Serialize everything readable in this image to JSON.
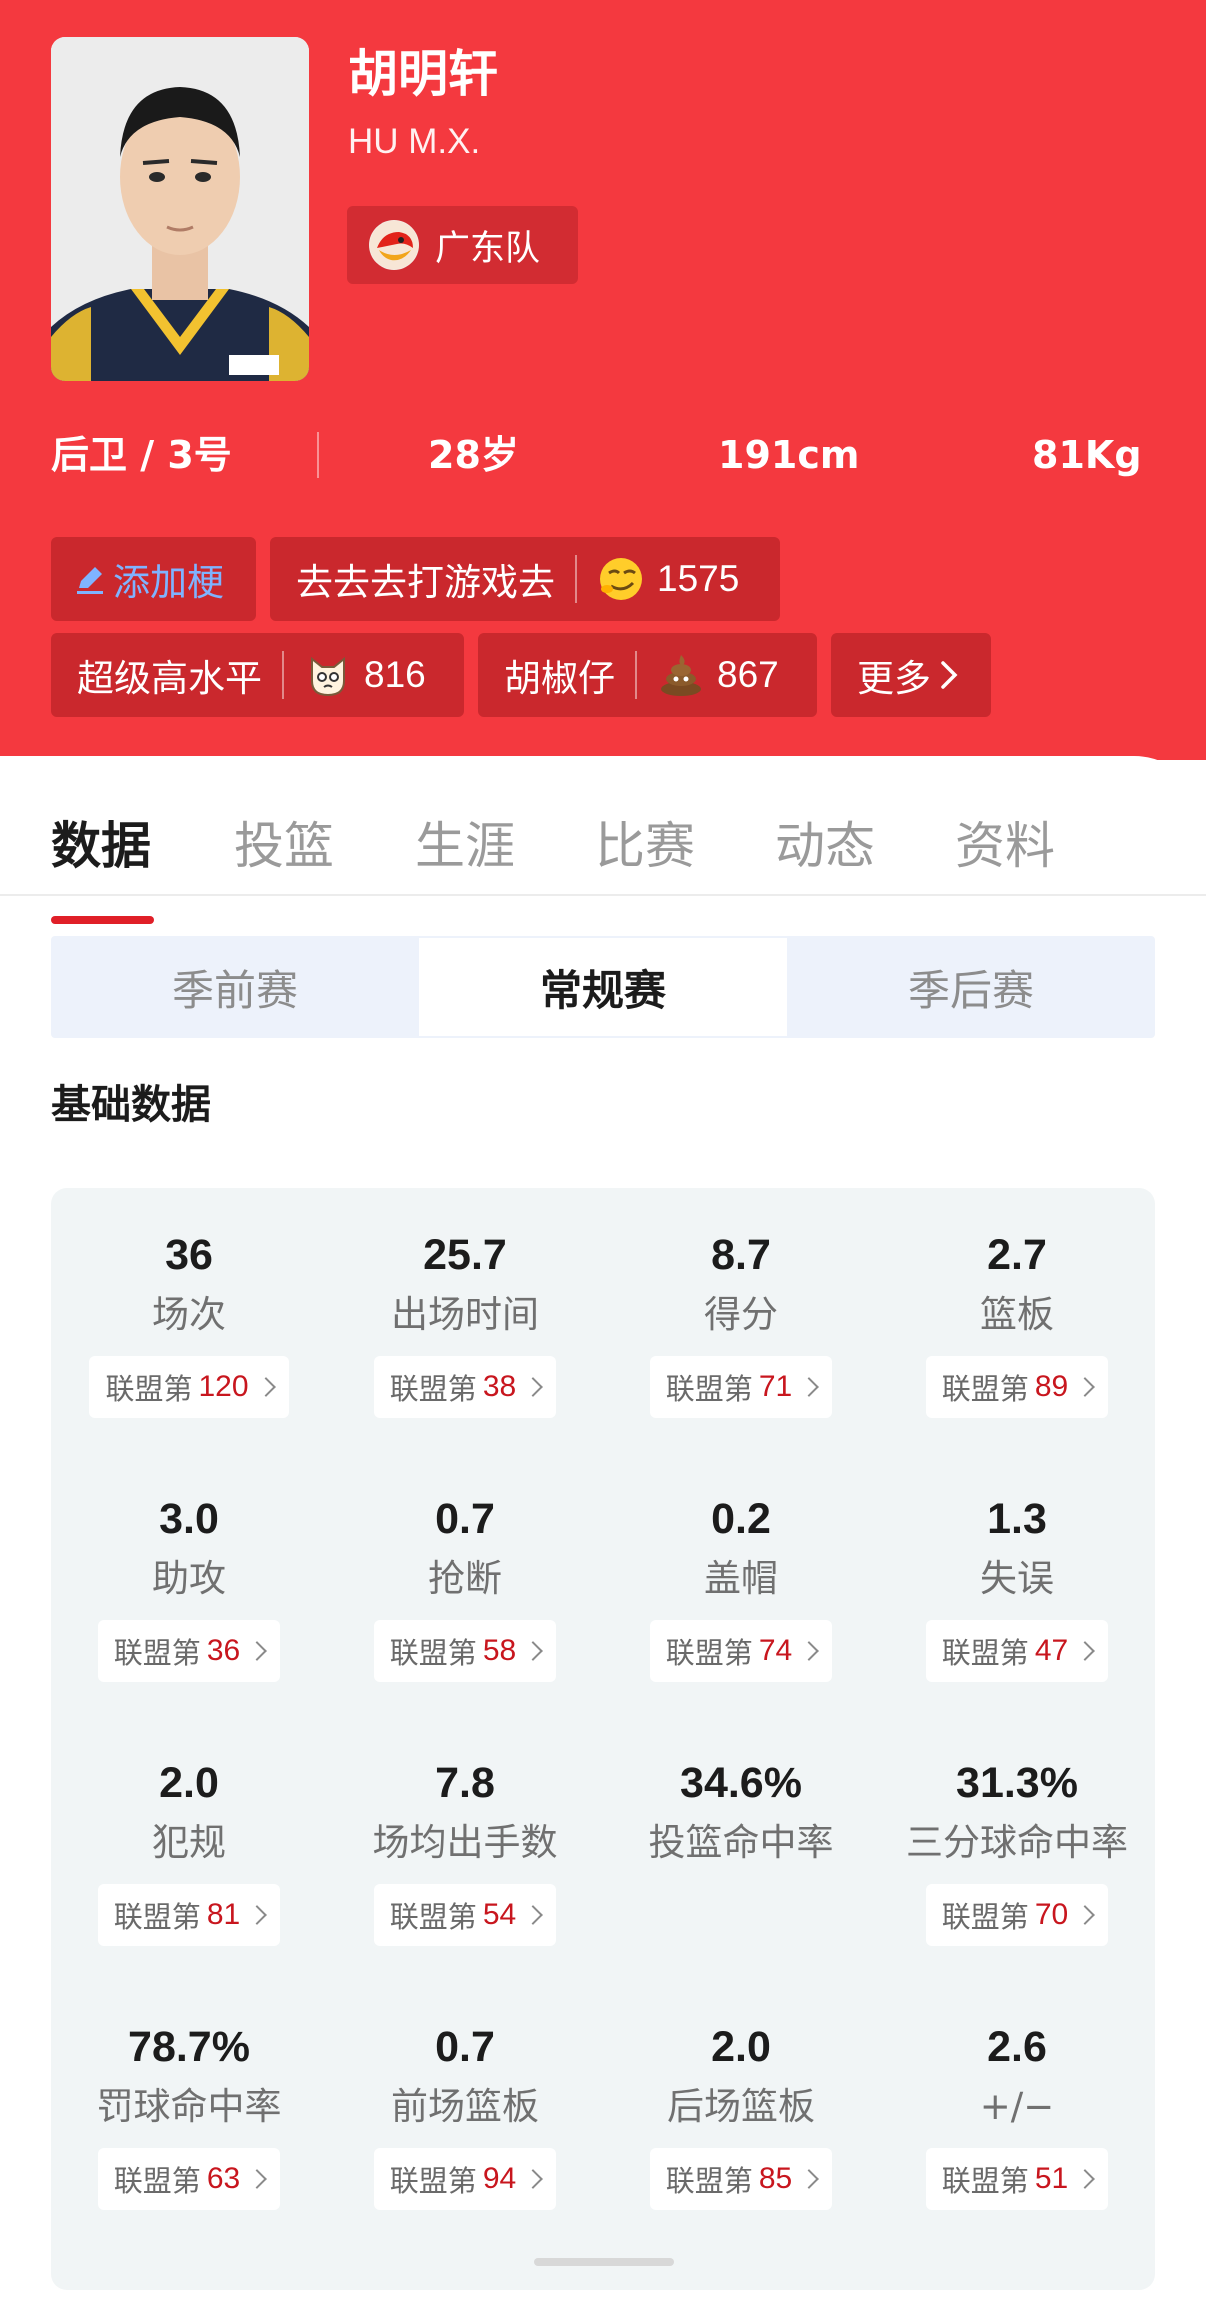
{
  "player": {
    "name": "胡明轩",
    "english_name": "HU M.X.",
    "team": "广东队",
    "position_number": "后卫 / 3号",
    "age": "28岁",
    "height": "191cm",
    "weight": "81Kg"
  },
  "tags": {
    "add_label": "添加梗",
    "items": [
      {
        "label": "去去去打游戏去",
        "count": "1575",
        "icon": "smirk-emoji-icon"
      },
      {
        "label": "超级高水平",
        "count": "816",
        "icon": "cat-emoji-icon"
      },
      {
        "label": "胡椒仔",
        "count": "867",
        "icon": "poop-emoji-icon"
      }
    ],
    "more_label": "更多"
  },
  "tabs": [
    "数据",
    "投篮",
    "生涯",
    "比赛",
    "动态",
    "资料"
  ],
  "active_tab": "数据",
  "season_types": [
    "季前赛",
    "常规赛",
    "季后赛"
  ],
  "active_season_type": "常规赛",
  "section_title": "基础数据",
  "rank_prefix": "联盟第",
  "stats": [
    {
      "value": "36",
      "label": "场次",
      "rank": "120"
    },
    {
      "value": "25.7",
      "label": "出场时间",
      "rank": "38"
    },
    {
      "value": "8.7",
      "label": "得分",
      "rank": "71"
    },
    {
      "value": "2.7",
      "label": "篮板",
      "rank": "89"
    },
    {
      "value": "3.0",
      "label": "助攻",
      "rank": "36"
    },
    {
      "value": "0.7",
      "label": "抢断",
      "rank": "58"
    },
    {
      "value": "0.2",
      "label": "盖帽",
      "rank": "74"
    },
    {
      "value": "1.3",
      "label": "失误",
      "rank": "47"
    },
    {
      "value": "2.0",
      "label": "犯规",
      "rank": "81"
    },
    {
      "value": "7.8",
      "label": "场均出手数",
      "rank": "54"
    },
    {
      "value": "34.6%",
      "label": "投篮命中率",
      "rank": null
    },
    {
      "value": "31.3%",
      "label": "三分球命中率",
      "rank": "70"
    },
    {
      "value": "78.7%",
      "label": "罚球命中率",
      "rank": "63"
    },
    {
      "value": "0.7",
      "label": "前场篮板",
      "rank": "94"
    },
    {
      "value": "2.0",
      "label": "后场篮板",
      "rank": "85"
    },
    {
      "value": "2.6",
      "label": "+/−",
      "rank": "51"
    }
  ],
  "colors": {
    "header_red": "#f4393f",
    "accent_red": "#e01f28",
    "rank_red": "#c8161e",
    "tag_add_blue": "#7fb3ff"
  }
}
